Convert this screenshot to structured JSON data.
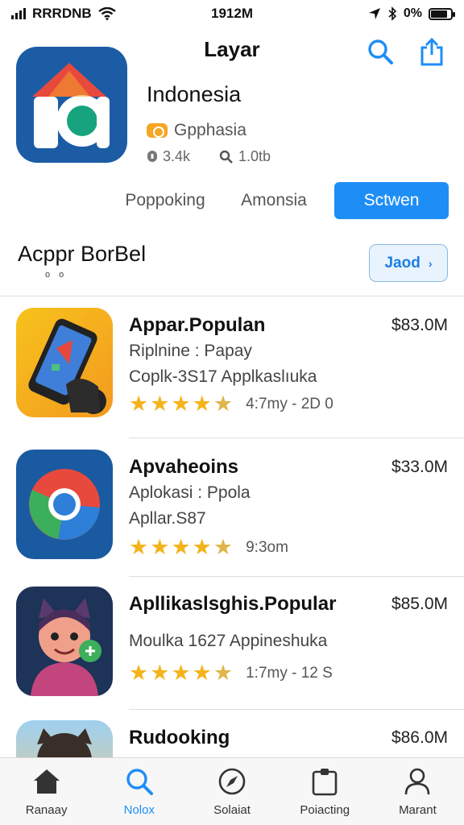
{
  "status_bar": {
    "carrier": "RRRDNB",
    "time": "1912M",
    "battery": "0%"
  },
  "header": {
    "title": "Layar"
  },
  "app": {
    "name": "Indonesia",
    "developer": "Gpphasia",
    "meta": {
      "downloads": "3.4k",
      "size": "1.0tb"
    }
  },
  "tabs": [
    {
      "label": "Poppoking"
    },
    {
      "label": "Amonsia"
    },
    {
      "label": "Sctwen",
      "active": true
    }
  ],
  "section": {
    "title": "Acppr BorBel",
    "subtitle": "o o",
    "see_all": "Jaod"
  },
  "apps": [
    {
      "title": "Appar.Populan",
      "line1": "Riplnine : Papay",
      "line2": "Coplk-3S17 Applkaslıuka",
      "price": "$83.0M",
      "rating": 4.5,
      "rating_text": "4:7my - 2D 0"
    },
    {
      "title": "Apvaheoins",
      "line1": "Aplokasi : Ppola",
      "line2": "Apllar.S87",
      "price": "$33.0M",
      "rating": 4.5,
      "rating_text": "9:3om"
    },
    {
      "title": "Apllikaslsghis.Popular",
      "line1": "",
      "line2": "Moulka 1627 Appineshuka",
      "price": "$85.0M",
      "rating": 4.5,
      "rating_text": "1:7my - 12 S"
    },
    {
      "title": "Rudooking",
      "line1": "",
      "line2": "",
      "price": "$86.0M",
      "rating": 0,
      "rating_text": ""
    }
  ],
  "nav": [
    {
      "label": "Ranaay",
      "icon": "home-icon"
    },
    {
      "label": "Nolox",
      "icon": "search-icon",
      "active": true
    },
    {
      "label": "Solaiat",
      "icon": "compass-icon"
    },
    {
      "label": "Poiacting",
      "icon": "clipboard-icon"
    },
    {
      "label": "Marant",
      "icon": "person-icon"
    }
  ],
  "colors": {
    "accent": "#1e8ef7",
    "star": "#f5b31b",
    "icon_blue": "#1c5ca4"
  }
}
